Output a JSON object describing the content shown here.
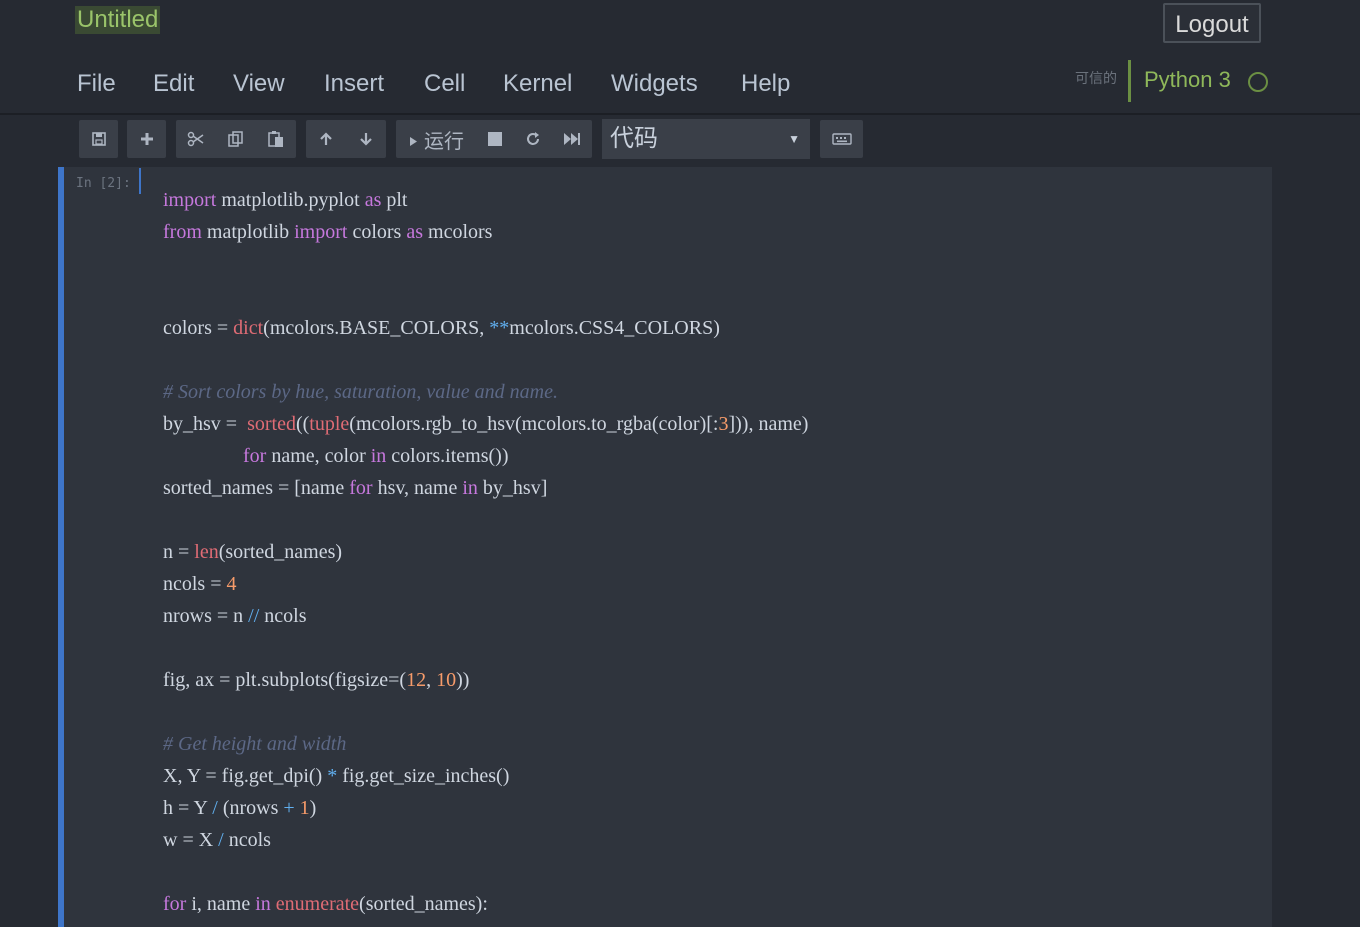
{
  "header": {
    "title": "Untitled",
    "logout_label": "Logout",
    "trusted_label": "可信的",
    "kernel_name": "Python 3"
  },
  "menu": {
    "items": [
      "File",
      "Edit",
      "View",
      "Insert",
      "Cell",
      "Kernel",
      "Widgets",
      "Help"
    ]
  },
  "toolbar": {
    "run_label": "运行",
    "cell_type": "代码",
    "icons": [
      "save-icon",
      "plus-icon",
      "cut-icon",
      "copy-icon",
      "paste-icon",
      "arrow-up-icon",
      "arrow-down-icon",
      "play-icon",
      "stop-icon",
      "restart-icon",
      "fast-forward-icon",
      "keyboard-icon"
    ]
  },
  "cell": {
    "prompt": "In  [2]:",
    "code_lines": [
      "import matplotlib.pyplot as plt",
      "from matplotlib import colors as mcolors",
      "",
      "",
      "colors = dict(mcolors.BASE_COLORS, **mcolors.CSS4_COLORS)",
      "",
      "# Sort colors by hue, saturation, value and name.",
      "by_hsv =  sorted((tuple(mcolors.rgb_to_hsv(mcolors.to_rgba(color)[:3])), name)",
      "                for name, color in colors.items())",
      "sorted_names = [name for hsv, name in by_hsv]",
      "",
      "n = len(sorted_names)",
      "ncols = 4",
      "nrows = n // ncols",
      "",
      "fig, ax = plt.subplots(figsize=(12, 10))",
      "",
      "# Get height and width",
      "X, Y = fig.get_dpi() * fig.get_size_inches()",
      "h = Y / (nrows + 1)",
      "w = X / ncols",
      "",
      "for i, name in enumerate(sorted_names):"
    ]
  }
}
